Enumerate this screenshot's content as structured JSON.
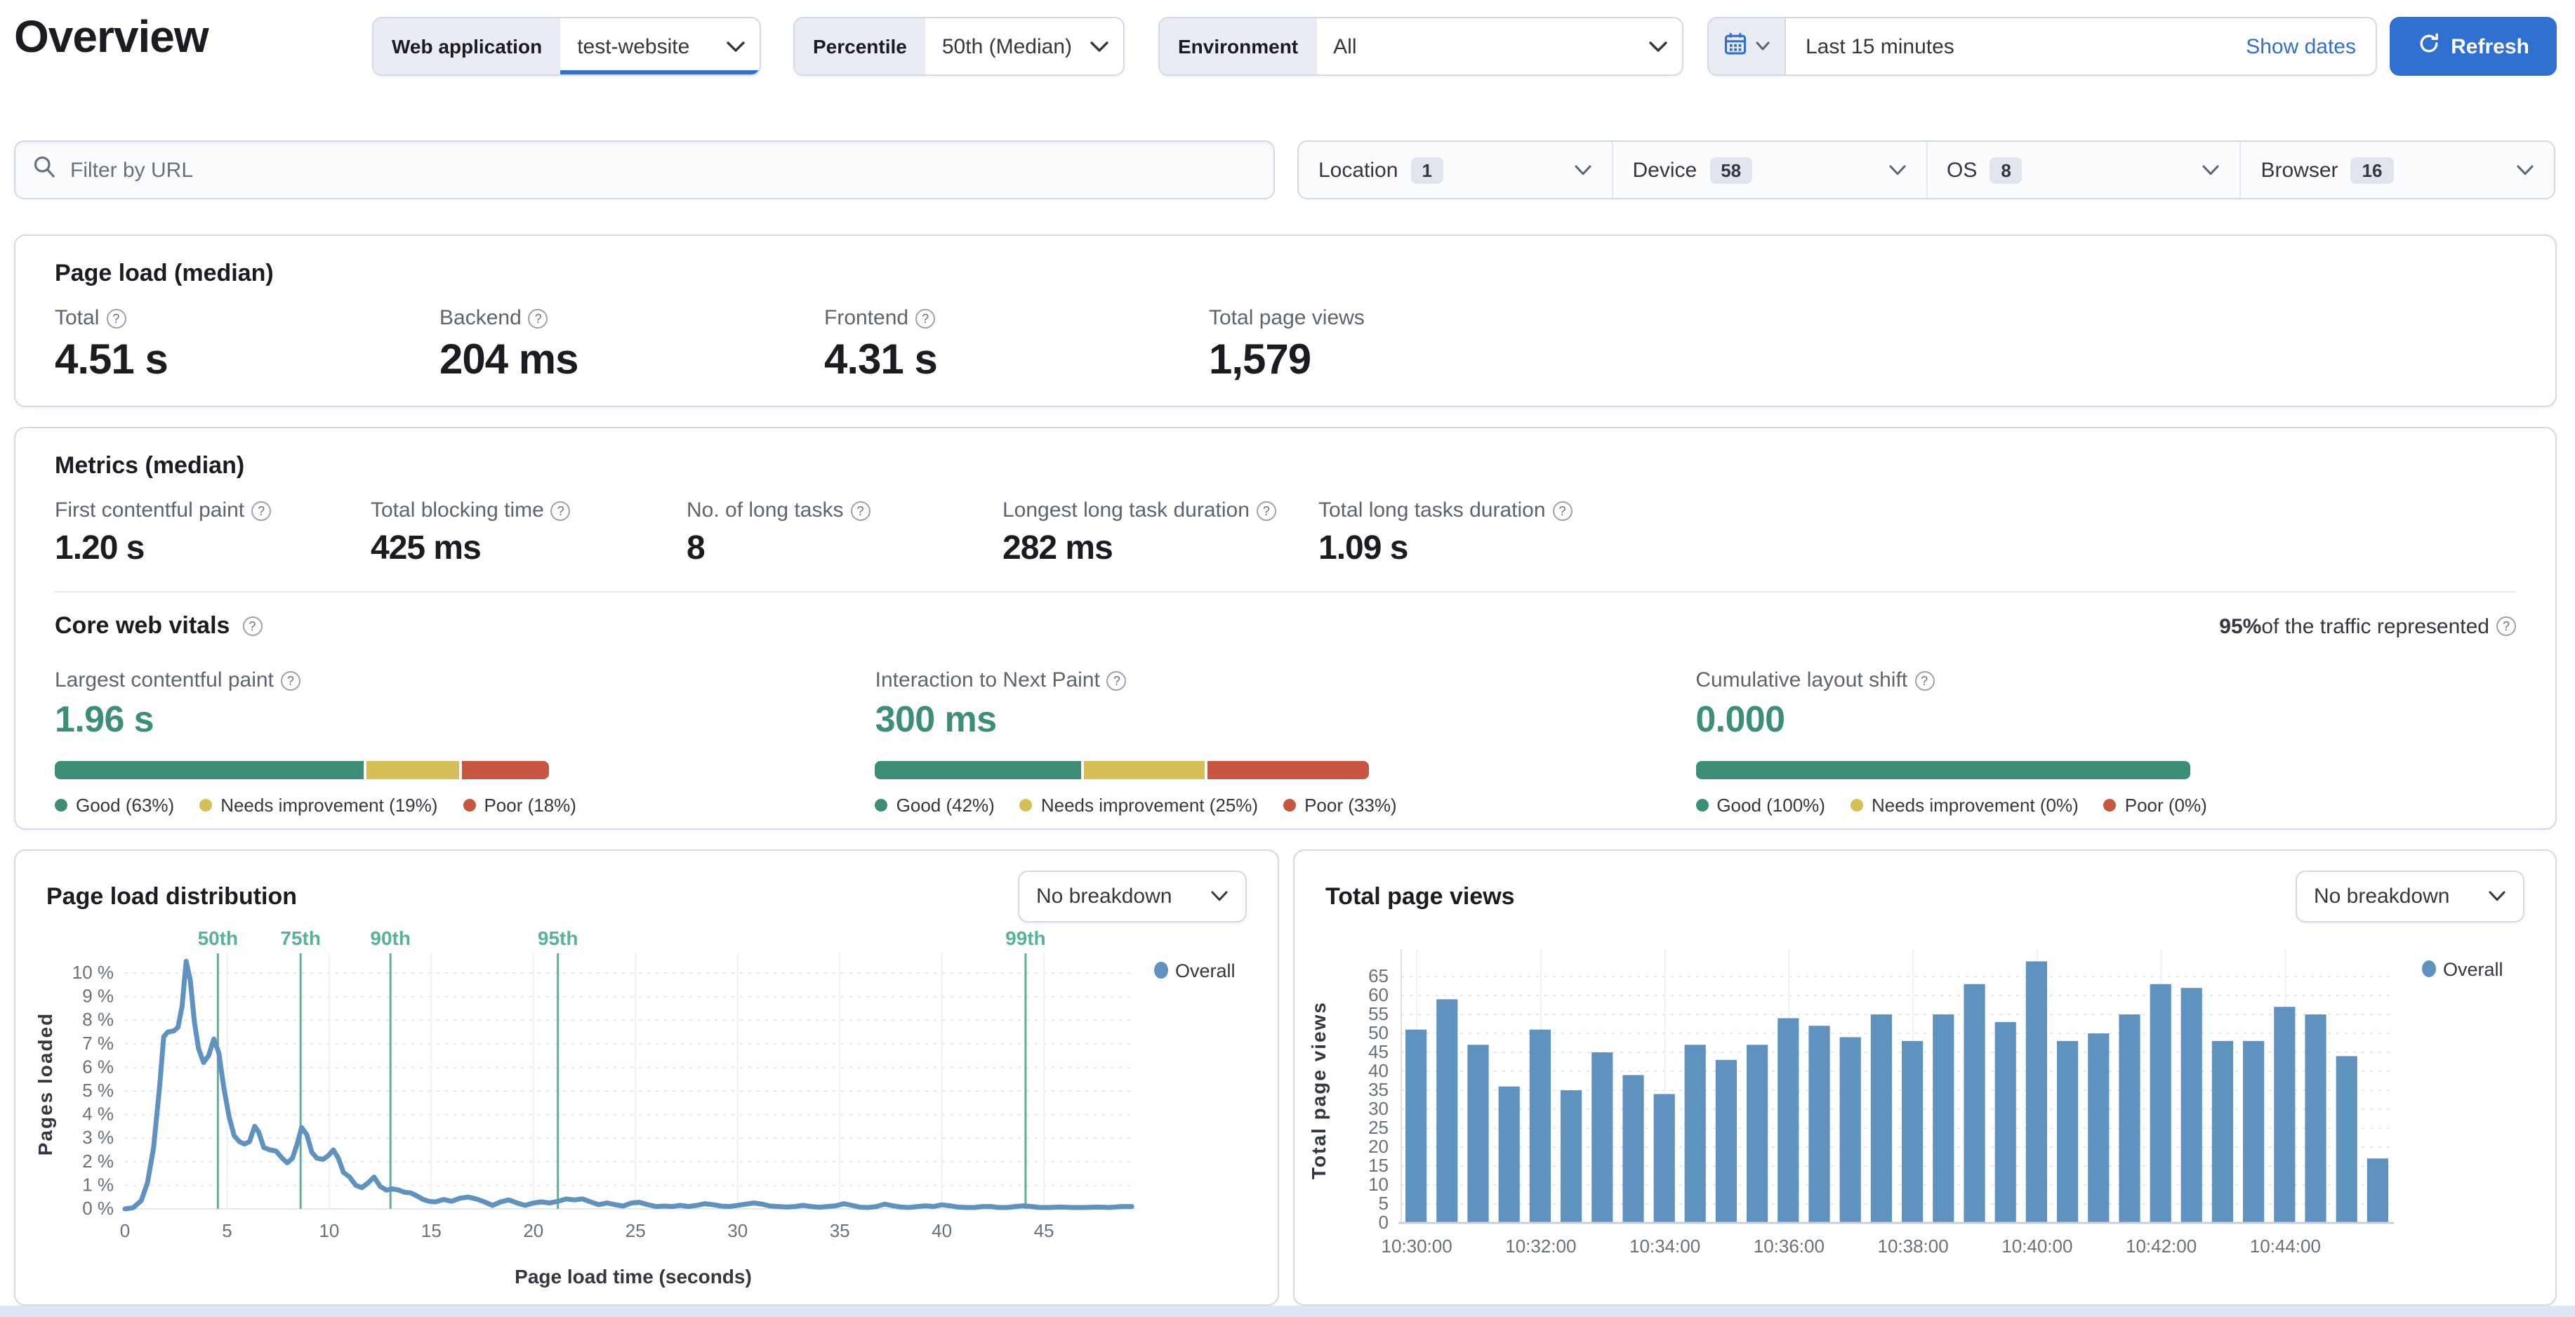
{
  "colors": {
    "accent_blue": "#2f70d0",
    "vis_blue": "#6092c0",
    "percentile_teal": "#54b399",
    "good": "#3d8e78",
    "needs_improvement": "#d6bf57",
    "poor": "#c6563f"
  },
  "header": {
    "title": "Overview",
    "web_application": {
      "label": "Web application",
      "value": "test-website"
    },
    "percentile": {
      "label": "Percentile",
      "value": "50th (Median)"
    },
    "environment": {
      "label": "Environment",
      "value": "All"
    },
    "date_picker": {
      "value": "Last 15 minutes",
      "show_dates": "Show dates"
    },
    "refresh_label": "Refresh"
  },
  "filters": {
    "url_placeholder": "Filter by URL",
    "groups": [
      {
        "label": "Location",
        "count": "1"
      },
      {
        "label": "Device",
        "count": "58"
      },
      {
        "label": "OS",
        "count": "8"
      },
      {
        "label": "Browser",
        "count": "16"
      }
    ]
  },
  "page_load": {
    "title": "Page load (median)",
    "metrics": [
      {
        "label": "Total",
        "value": "4.51 s"
      },
      {
        "label": "Backend",
        "value": "204 ms"
      },
      {
        "label": "Frontend",
        "value": "4.31 s"
      },
      {
        "label": "Total page views",
        "value": "1,579"
      }
    ]
  },
  "metrics_median": {
    "title": "Metrics (median)",
    "metrics": [
      {
        "label": "First contentful paint",
        "value": "1.20 s"
      },
      {
        "label": "Total blocking time",
        "value": "425 ms"
      },
      {
        "label": "No. of long tasks",
        "value": "8"
      },
      {
        "label": "Longest long task duration",
        "value": "282 ms"
      },
      {
        "label": "Total long tasks duration",
        "value": "1.09 s"
      }
    ]
  },
  "core_web_vitals": {
    "title": "Core web vitals",
    "traffic_percent": "95%",
    "traffic_text": " of the traffic represented",
    "vitals": [
      {
        "label": "Largest contentful paint",
        "value": "1.96 s",
        "good": 63,
        "needs": 19,
        "poor": 18,
        "legend": [
          "Good (63%)",
          "Needs improvement (19%)",
          "Poor (18%)"
        ]
      },
      {
        "label": "Interaction to Next Paint",
        "value": "300 ms",
        "good": 42,
        "needs": 25,
        "poor": 33,
        "legend": [
          "Good (42%)",
          "Needs improvement (25%)",
          "Poor (33%)"
        ]
      },
      {
        "label": "Cumulative layout shift",
        "value": "0.000",
        "good": 100,
        "needs": 0,
        "poor": 0,
        "legend": [
          "Good (100%)",
          "Needs improvement (0%)",
          "Poor (0%)"
        ]
      }
    ]
  },
  "distribution_card": {
    "title": "Page load distribution",
    "breakdown": "No breakdown",
    "legend": "Overall",
    "xlabel": "Page load time (seconds)",
    "ylabel": "Pages loaded"
  },
  "views_card": {
    "title": "Total page views",
    "breakdown": "No breakdown",
    "legend": "Overall",
    "ylabel": "Total page views"
  },
  "chart_data": [
    {
      "type": "line",
      "title": "Page load distribution",
      "xlabel": "Page load time (seconds)",
      "ylabel": "Pages loaded",
      "legend_entries": [
        "Overall"
      ],
      "legend_position": "top-right",
      "grid": true,
      "xlim": [
        0,
        49.5
      ],
      "ylim": [
        0,
        10.6
      ],
      "x_ticks": [
        0,
        5,
        10,
        15,
        20,
        25,
        30,
        35,
        40,
        45
      ],
      "y_ticks": [
        0,
        1,
        2,
        3,
        4,
        5,
        6,
        7,
        8,
        9,
        10
      ],
      "y_tick_suffix": " %",
      "percentile_markers": [
        {
          "label": "50th",
          "x": 4.55
        },
        {
          "label": "75th",
          "x": 8.6
        },
        {
          "label": "90th",
          "x": 13.0
        },
        {
          "label": "95th",
          "x": 21.2
        },
        {
          "label": "99th",
          "x": 44.1
        }
      ],
      "series": [
        {
          "name": "Overall",
          "points": [
            [
              0,
              0
            ],
            [
              0.4,
              0.05
            ],
            [
              0.8,
              0.35
            ],
            [
              1.1,
              1.1
            ],
            [
              1.4,
              2.6
            ],
            [
              1.7,
              5.2
            ],
            [
              1.9,
              7.3
            ],
            [
              2.1,
              7.5
            ],
            [
              2.4,
              7.55
            ],
            [
              2.6,
              7.7
            ],
            [
              2.8,
              8.6
            ],
            [
              3.0,
              10.5
            ],
            [
              3.2,
              9.7
            ],
            [
              3.4,
              7.9
            ],
            [
              3.6,
              6.8
            ],
            [
              3.85,
              6.2
            ],
            [
              4.1,
              6.5
            ],
            [
              4.35,
              7.2
            ],
            [
              4.6,
              6.6
            ],
            [
              4.85,
              5.1
            ],
            [
              5.1,
              3.9
            ],
            [
              5.35,
              3.1
            ],
            [
              5.6,
              2.85
            ],
            [
              5.85,
              2.75
            ],
            [
              6.1,
              2.85
            ],
            [
              6.35,
              3.5
            ],
            [
              6.55,
              3.25
            ],
            [
              6.8,
              2.6
            ],
            [
              7.1,
              2.5
            ],
            [
              7.4,
              2.45
            ],
            [
              7.7,
              2.15
            ],
            [
              7.95,
              1.95
            ],
            [
              8.2,
              2.15
            ],
            [
              8.45,
              2.8
            ],
            [
              8.65,
              3.45
            ],
            [
              8.9,
              3.15
            ],
            [
              9.15,
              2.4
            ],
            [
              9.4,
              2.15
            ],
            [
              9.7,
              2.1
            ],
            [
              9.95,
              2.25
            ],
            [
              10.2,
              2.5
            ],
            [
              10.45,
              2.15
            ],
            [
              10.7,
              1.55
            ],
            [
              11.0,
              1.35
            ],
            [
              11.3,
              1.0
            ],
            [
              11.6,
              0.9
            ],
            [
              11.9,
              1.1
            ],
            [
              12.2,
              1.35
            ],
            [
              12.5,
              0.95
            ],
            [
              12.8,
              0.8
            ],
            [
              13.1,
              0.85
            ],
            [
              13.4,
              0.8
            ],
            [
              13.7,
              0.7
            ],
            [
              14.0,
              0.68
            ],
            [
              14.3,
              0.55
            ],
            [
              14.6,
              0.4
            ],
            [
              14.9,
              0.32
            ],
            [
              15.2,
              0.3
            ],
            [
              15.6,
              0.4
            ],
            [
              16.0,
              0.32
            ],
            [
              16.4,
              0.45
            ],
            [
              16.8,
              0.5
            ],
            [
              17.2,
              0.42
            ],
            [
              17.6,
              0.3
            ],
            [
              18.0,
              0.15
            ],
            [
              18.4,
              0.3
            ],
            [
              18.8,
              0.38
            ],
            [
              19.2,
              0.25
            ],
            [
              19.6,
              0.15
            ],
            [
              20.0,
              0.25
            ],
            [
              20.4,
              0.3
            ],
            [
              20.8,
              0.25
            ],
            [
              21.2,
              0.32
            ],
            [
              21.6,
              0.42
            ],
            [
              22.0,
              0.38
            ],
            [
              22.4,
              0.42
            ],
            [
              22.8,
              0.3
            ],
            [
              23.2,
              0.18
            ],
            [
              23.6,
              0.25
            ],
            [
              24.0,
              0.18
            ],
            [
              24.4,
              0.12
            ],
            [
              24.8,
              0.25
            ],
            [
              25.2,
              0.28
            ],
            [
              25.6,
              0.18
            ],
            [
              26.0,
              0.1
            ],
            [
              26.4,
              0.12
            ],
            [
              26.8,
              0.1
            ],
            [
              27.2,
              0.15
            ],
            [
              27.6,
              0.1
            ],
            [
              28.0,
              0.15
            ],
            [
              28.4,
              0.22
            ],
            [
              28.8,
              0.18
            ],
            [
              29.2,
              0.12
            ],
            [
              29.6,
              0.1
            ],
            [
              30.0,
              0.15
            ],
            [
              30.4,
              0.2
            ],
            [
              30.8,
              0.25
            ],
            [
              31.2,
              0.2
            ],
            [
              31.6,
              0.12
            ],
            [
              32.0,
              0.1
            ],
            [
              32.4,
              0.08
            ],
            [
              32.8,
              0.1
            ],
            [
              33.2,
              0.15
            ],
            [
              33.6,
              0.1
            ],
            [
              34.0,
              0.07
            ],
            [
              34.4,
              0.1
            ],
            [
              34.8,
              0.13
            ],
            [
              35.2,
              0.22
            ],
            [
              35.6,
              0.15
            ],
            [
              36.0,
              0.07
            ],
            [
              36.4,
              0.06
            ],
            [
              36.8,
              0.1
            ],
            [
              37.2,
              0.2
            ],
            [
              37.6,
              0.13
            ],
            [
              38.0,
              0.08
            ],
            [
              38.4,
              0.06
            ],
            [
              38.8,
              0.1
            ],
            [
              39.2,
              0.13
            ],
            [
              39.6,
              0.1
            ],
            [
              40.0,
              0.17
            ],
            [
              40.4,
              0.13
            ],
            [
              40.8,
              0.08
            ],
            [
              41.2,
              0.06
            ],
            [
              41.6,
              0.06
            ],
            [
              42.0,
              0.1
            ],
            [
              42.4,
              0.1
            ],
            [
              42.8,
              0.06
            ],
            [
              43.2,
              0.06
            ],
            [
              43.6,
              0.1
            ],
            [
              44.0,
              0.13
            ],
            [
              44.4,
              0.1
            ],
            [
              44.8,
              0.06
            ],
            [
              45.2,
              0.06
            ],
            [
              45.8,
              0.08
            ],
            [
              46.4,
              0.06
            ],
            [
              47.0,
              0.06
            ],
            [
              47.6,
              0.08
            ],
            [
              48.2,
              0.06
            ],
            [
              48.8,
              0.1
            ],
            [
              49.3,
              0.1
            ]
          ]
        }
      ]
    },
    {
      "type": "bar",
      "title": "Total page views",
      "ylabel": "Total page views",
      "legend_entries": [
        "Overall"
      ],
      "legend_position": "top-right",
      "grid": true,
      "ylim": [
        0,
        70
      ],
      "y_ticks": [
        0,
        5,
        10,
        15,
        20,
        25,
        30,
        35,
        40,
        45,
        50,
        55,
        60,
        65
      ],
      "categories": [
        "10:30:00",
        "10:30:30",
        "10:31:00",
        "10:31:30",
        "10:32:00",
        "10:32:30",
        "10:33:00",
        "10:33:30",
        "10:34:00",
        "10:34:30",
        "10:35:00",
        "10:35:30",
        "10:36:00",
        "10:36:30",
        "10:37:00",
        "10:37:30",
        "10:38:00",
        "10:38:30",
        "10:39:00",
        "10:39:30",
        "10:40:00",
        "10:40:30",
        "10:41:00",
        "10:41:30",
        "10:42:00",
        "10:42:30",
        "10:43:00",
        "10:43:30",
        "10:44:00",
        "10:44:30",
        "10:45:00",
        "10:45:30"
      ],
      "values": [
        51,
        59,
        47,
        36,
        51,
        35,
        45,
        39,
        34,
        47,
        43,
        47,
        54,
        52,
        49,
        55,
        48,
        55,
        63,
        53,
        69,
        48,
        50,
        55,
        63,
        62,
        48,
        48,
        57,
        55,
        44,
        17
      ],
      "x_label_every": 4,
      "x_tick_labels": [
        "10:30:00",
        "10:32:00",
        "10:34:00",
        "10:36:00",
        "10:38:00",
        "10:40:00",
        "10:42:00",
        "10:44:00"
      ]
    }
  ]
}
